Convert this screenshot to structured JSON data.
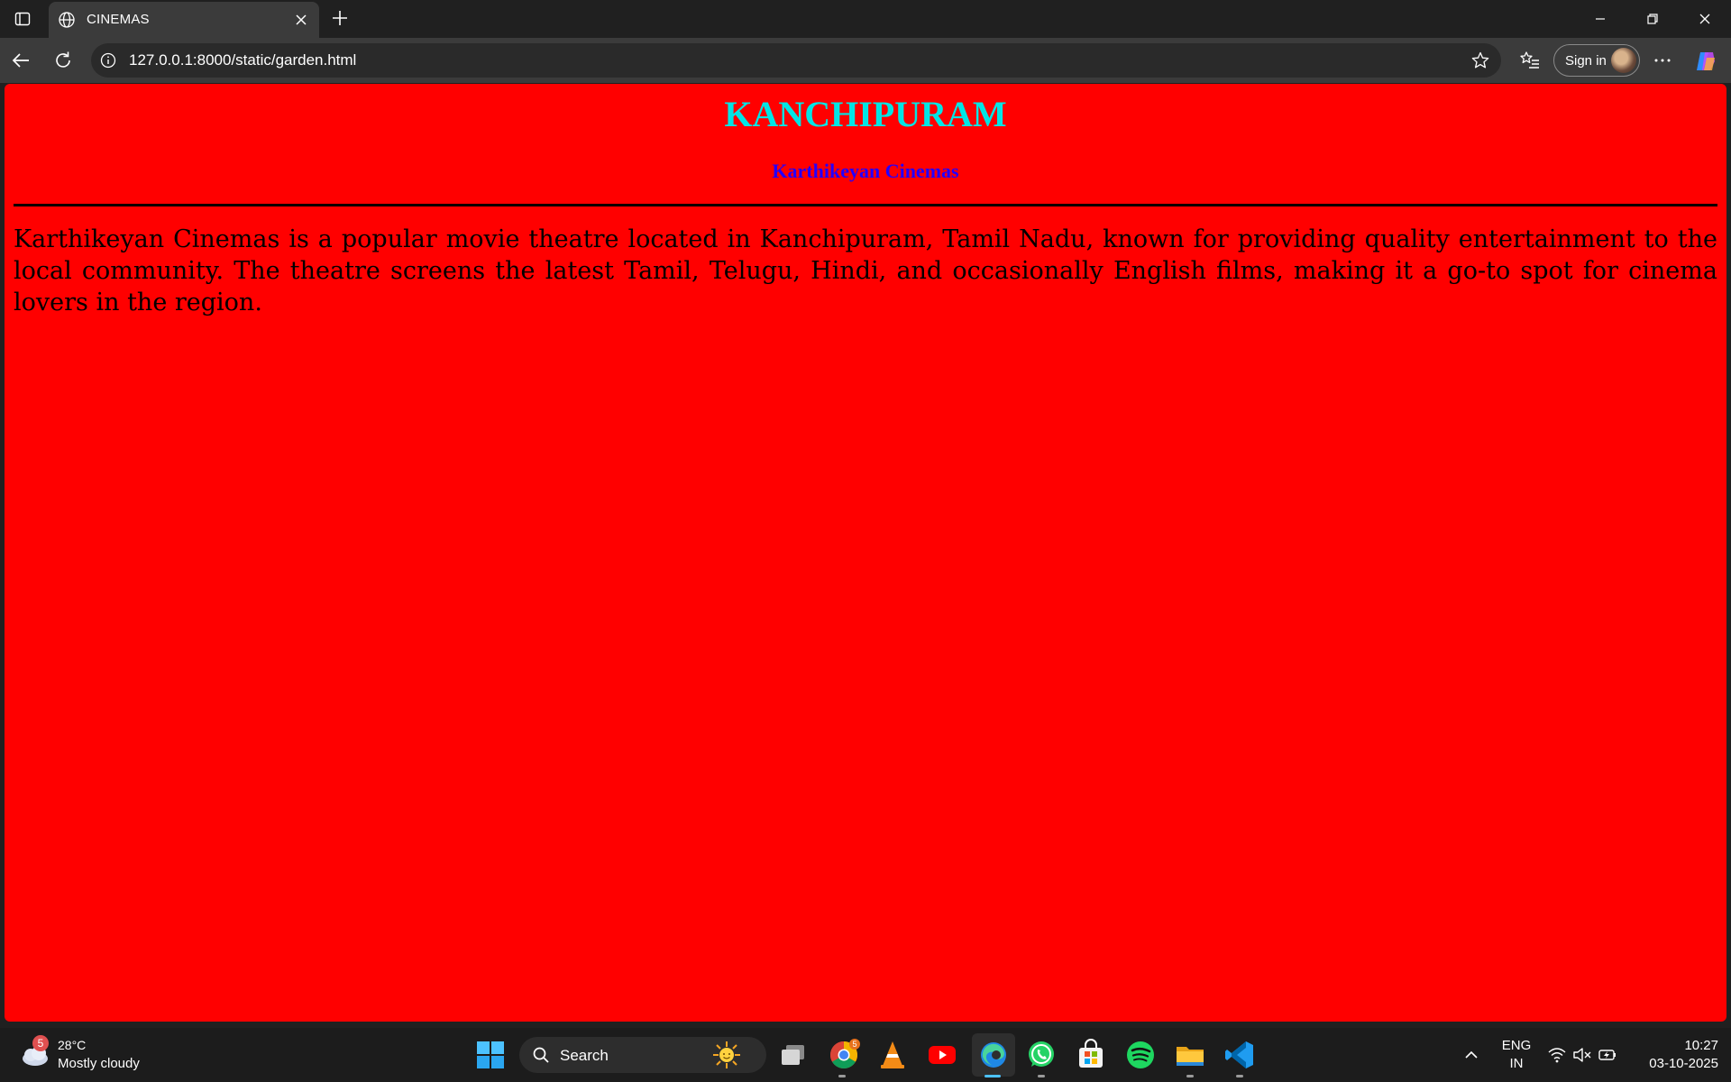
{
  "browser": {
    "tab": {
      "title": "CINEMAS"
    },
    "address_bar": {
      "url": "127.0.0.1:8000/static/garden.html"
    },
    "signin_label": "Sign in"
  },
  "page": {
    "title": "KANCHIPURAM",
    "subtitle": "Karthikeyan Cinemas",
    "body": "Karthikeyan Cinemas is a popular movie theatre located in Kanchipuram, Tamil Nadu, known for providing quality entertainment to the local community. The theatre screens the latest Tamil, Telugu, Hindi, and occasionally English films, making it a go-to spot for cinema lovers in the region.",
    "colors": {
      "background": "#ff0000",
      "title": "#00e5e5",
      "subtitle": "#2400ff",
      "body": "#000000"
    }
  },
  "taskbar": {
    "weather": {
      "badge": "5",
      "temp": "28°C",
      "condition": "Mostly cloudy"
    },
    "search_label": "Search",
    "chrome_badge": "5",
    "tray": {
      "lang_line1": "ENG",
      "lang_line2": "IN"
    },
    "clock": {
      "time": "10:27",
      "date": "03-10-2025"
    },
    "apps": [
      "start-icon",
      "task-view-icon",
      "chrome-icon",
      "vlc-icon",
      "youtube-icon",
      "edge-icon",
      "whatsapp-icon",
      "microsoft-store-icon",
      "spotify-icon",
      "file-explorer-icon",
      "vscode-icon"
    ]
  }
}
